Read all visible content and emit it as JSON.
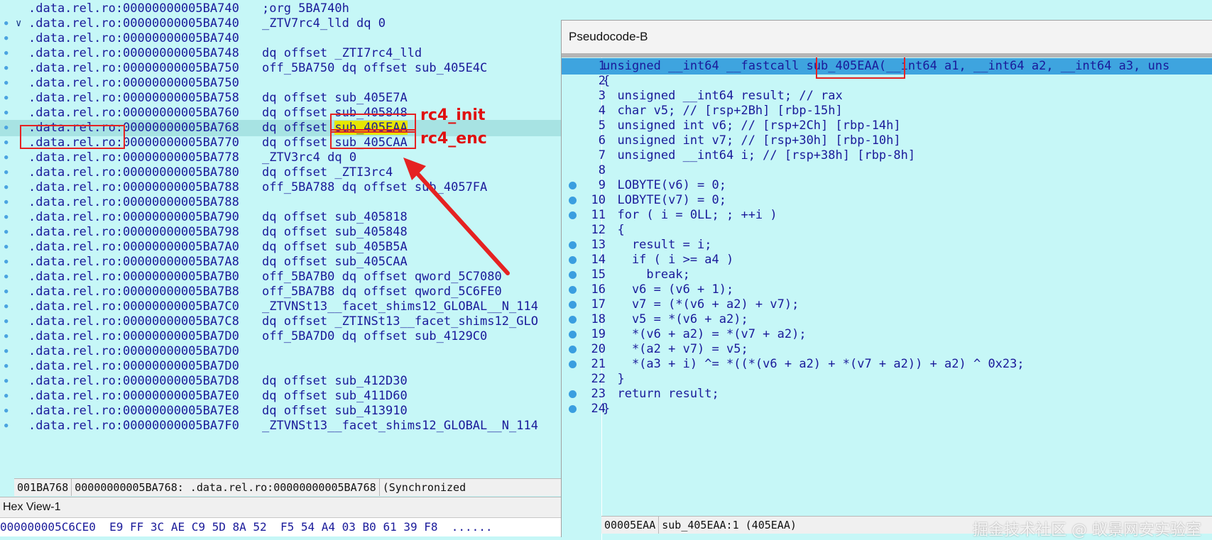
{
  "disasm": {
    "lines": [
      {
        "addr": ".data.rel.ro:00000000005BA740",
        "rest": ";org 5BA740h",
        "dot": false,
        "chev": false
      },
      {
        "addr": ".data.rel.ro:00000000005BA740",
        "rest": "_ZTV7rc4_lld dq 0",
        "dot": true,
        "chev": true
      },
      {
        "addr": ".data.rel.ro:00000000005BA740",
        "rest": "",
        "dot": true,
        "chev": false
      },
      {
        "addr": ".data.rel.ro:00000000005BA748",
        "rest": "dq offset _ZTI7rc4_lld",
        "dot": true,
        "chev": false
      },
      {
        "addr": ".data.rel.ro:00000000005BA750",
        "rest": "off_5BA750 dq offset sub_405E4C",
        "dot": true,
        "chev": false
      },
      {
        "addr": ".data.rel.ro:00000000005BA750",
        "rest": "",
        "dot": true,
        "chev": false
      },
      {
        "addr": ".data.rel.ro:00000000005BA758",
        "rest": "dq offset sub_405E7A",
        "dot": true,
        "chev": false
      },
      {
        "addr": ".data.rel.ro:00000000005BA760",
        "rest": "dq offset sub_405848",
        "dot": true,
        "chev": false
      },
      {
        "addr": ".data.rel.ro:00000000005BA768",
        "rest": "dq offset sub_405EAA",
        "dot": true,
        "chev": false
      },
      {
        "addr": ".data.rel.ro:00000000005BA770",
        "rest": "dq offset sub_405CAA",
        "dot": true,
        "chev": false
      },
      {
        "addr": ".data.rel.ro:00000000005BA778",
        "rest": "_ZTV3rc4 dq 0",
        "dot": true,
        "chev": false
      },
      {
        "addr": ".data.rel.ro:00000000005BA780",
        "rest": "dq offset _ZTI3rc4",
        "dot": true,
        "chev": false
      },
      {
        "addr": ".data.rel.ro:00000000005BA788",
        "rest": "off_5BA788 dq offset sub_4057FA",
        "dot": true,
        "chev": false
      },
      {
        "addr": ".data.rel.ro:00000000005BA788",
        "rest": "",
        "dot": true,
        "chev": false
      },
      {
        "addr": ".data.rel.ro:00000000005BA790",
        "rest": "dq offset sub_405818",
        "dot": true,
        "chev": false
      },
      {
        "addr": ".data.rel.ro:00000000005BA798",
        "rest": "dq offset sub_405848",
        "dot": true,
        "chev": false
      },
      {
        "addr": ".data.rel.ro:00000000005BA7A0",
        "rest": "dq offset sub_405B5A",
        "dot": true,
        "chev": false
      },
      {
        "addr": ".data.rel.ro:00000000005BA7A8",
        "rest": "dq offset sub_405CAA",
        "dot": true,
        "chev": false
      },
      {
        "addr": ".data.rel.ro:00000000005BA7B0",
        "rest": "off_5BA7B0 dq offset qword_5C7080",
        "dot": true,
        "chev": false
      },
      {
        "addr": ".data.rel.ro:00000000005BA7B8",
        "rest": "off_5BA7B8 dq offset qword_5C6FE0",
        "dot": true,
        "chev": false
      },
      {
        "addr": ".data.rel.ro:00000000005BA7C0",
        "rest": "_ZTVNSt13__facet_shims12_GLOBAL__N_114",
        "dot": true,
        "chev": false
      },
      {
        "addr": ".data.rel.ro:00000000005BA7C8",
        "rest": "dq offset _ZTINSt13__facet_shims12_GLO",
        "dot": true,
        "chev": false
      },
      {
        "addr": ".data.rel.ro:00000000005BA7D0",
        "rest": "off_5BA7D0 dq offset sub_4129C0",
        "dot": true,
        "chev": false
      },
      {
        "addr": ".data.rel.ro:00000000005BA7D0",
        "rest": "",
        "dot": true,
        "chev": false
      },
      {
        "addr": ".data.rel.ro:00000000005BA7D0",
        "rest": "",
        "dot": true,
        "chev": false
      },
      {
        "addr": ".data.rel.ro:00000000005BA7D8",
        "rest": "dq offset sub_412D30",
        "dot": true,
        "chev": false
      },
      {
        "addr": ".data.rel.ro:00000000005BA7E0",
        "rest": "dq offset sub_411D60",
        "dot": true,
        "chev": false
      },
      {
        "addr": ".data.rel.ro:00000000005BA7E8",
        "rest": "dq offset sub_413910",
        "dot": true,
        "chev": false
      },
      {
        "addr": ".data.rel.ro:00000000005BA7F0",
        "rest": "_ZTVNSt13__facet_shims12_GLOBAL__N_114",
        "dot": true,
        "chev": false
      }
    ],
    "annotations": {
      "init_label": "rc4_init",
      "enc_label": "rc4_enc"
    },
    "status": {
      "offset": "001BA768",
      "location": "00000000005BA768: .data.rel.ro:00000000005BA768",
      "sync": "(Synchronized"
    },
    "hex": {
      "title": "Hex View-1",
      "line": "000000005C6CE0  E9 FF 3C AE C9 5D 8A 52  F5 54 A4 03 B0 61 39 F8  ......"
    }
  },
  "pseudocode": {
    "title": "Pseudocode-B",
    "lines": [
      {
        "n": "1",
        "bp": false,
        "text": "unsigned __int64 __fastcall sub_405EAA(__int64 a1, __int64 a2, __int64 a3, uns"
      },
      {
        "n": "2",
        "bp": false,
        "text": "{"
      },
      {
        "n": "3",
        "bp": false,
        "text": "  unsigned __int64 result; // rax"
      },
      {
        "n": "4",
        "bp": false,
        "text": "  char v5; // [rsp+2Bh] [rbp-15h]"
      },
      {
        "n": "5",
        "bp": false,
        "text": "  unsigned int v6; // [rsp+2Ch] [rbp-14h]"
      },
      {
        "n": "6",
        "bp": false,
        "text": "  unsigned int v7; // [rsp+30h] [rbp-10h]"
      },
      {
        "n": "7",
        "bp": false,
        "text": "  unsigned __int64 i; // [rsp+38h] [rbp-8h]"
      },
      {
        "n": "8",
        "bp": false,
        "text": ""
      },
      {
        "n": "9",
        "bp": true,
        "text": "  LOBYTE(v6) = 0;"
      },
      {
        "n": "10",
        "bp": true,
        "text": "  LOBYTE(v7) = 0;"
      },
      {
        "n": "11",
        "bp": true,
        "text": "  for ( i = 0LL; ; ++i )"
      },
      {
        "n": "12",
        "bp": false,
        "text": "  {"
      },
      {
        "n": "13",
        "bp": true,
        "text": "    result = i;"
      },
      {
        "n": "14",
        "bp": true,
        "text": "    if ( i >= a4 )"
      },
      {
        "n": "15",
        "bp": true,
        "text": "      break;"
      },
      {
        "n": "16",
        "bp": true,
        "text": "    v6 = (v6 + 1);"
      },
      {
        "n": "17",
        "bp": true,
        "text": "    v7 = (*(v6 + a2) + v7);"
      },
      {
        "n": "18",
        "bp": true,
        "text": "    v5 = *(v6 + a2);"
      },
      {
        "n": "19",
        "bp": true,
        "text": "    *(v6 + a2) = *(v7 + a2);"
      },
      {
        "n": "20",
        "bp": true,
        "text": "    *(a2 + v7) = v5;"
      },
      {
        "n": "21",
        "bp": true,
        "text": "    *(a3 + i) ^= *((*(v6 + a2) + *(v7 + a2)) + a2) ^ 0x23;"
      },
      {
        "n": "22",
        "bp": false,
        "text": "  }"
      },
      {
        "n": "23",
        "bp": true,
        "text": "  return result;"
      },
      {
        "n": "24",
        "bp": true,
        "text": "}"
      }
    ],
    "status": {
      "offset": "00005EAA",
      "location": "sub_405EAA:1 (405EAA)"
    },
    "watermark": "掘金技术社区 @ 蚁景网安实验室"
  },
  "colors": {
    "background": "#c6f7f7",
    "highlight_box": "#e52222",
    "current_line": "#3ea4df",
    "yellow": "#e6e600"
  }
}
